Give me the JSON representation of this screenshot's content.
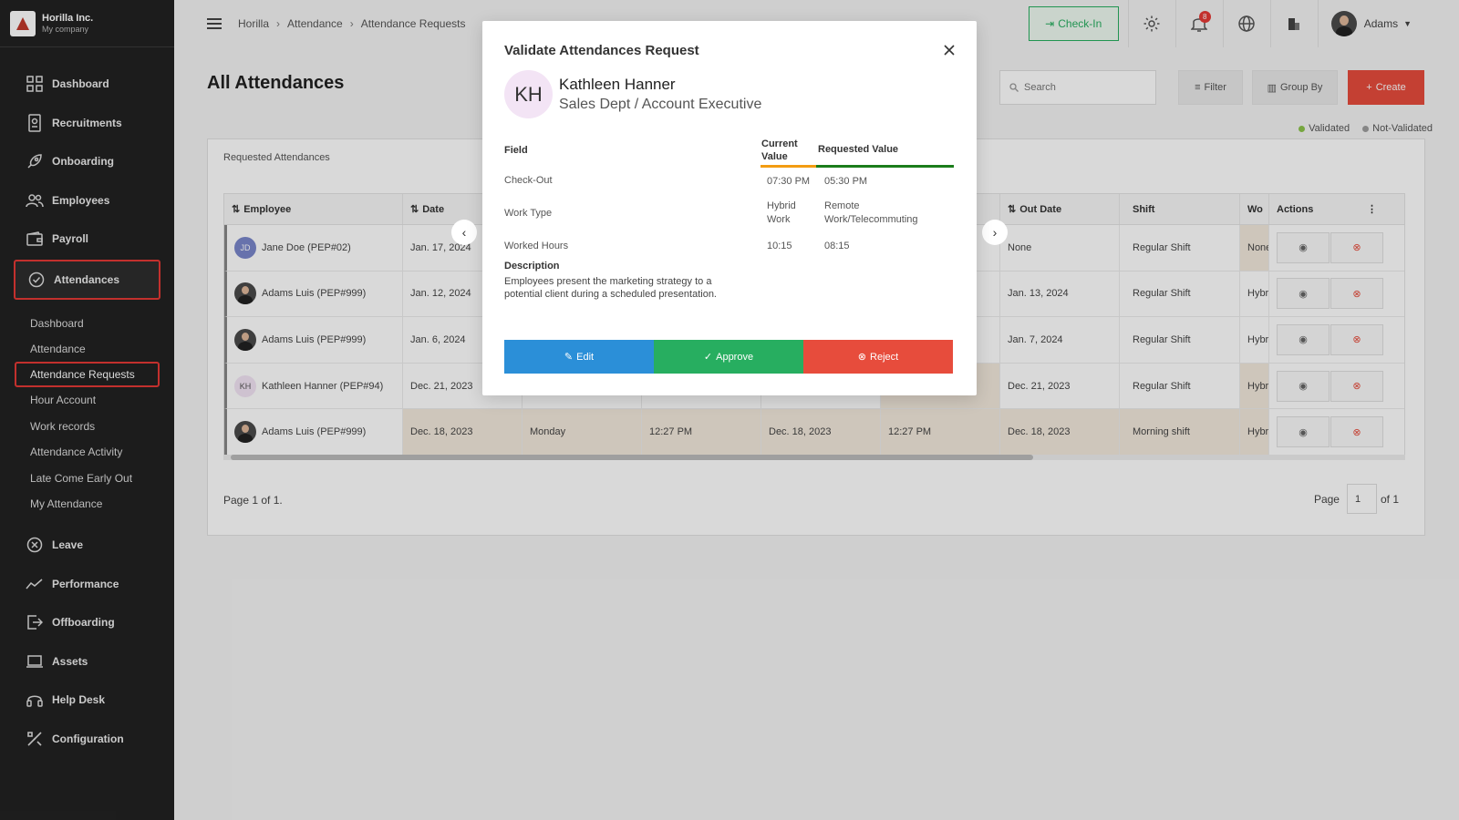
{
  "brand": {
    "name": "Horilla Inc.",
    "sub": "My company"
  },
  "sidebar": {
    "top_items": [
      {
        "label": "Dashboard",
        "icon": "grid-icon"
      },
      {
        "label": "Recruitments",
        "icon": "id-card-icon"
      },
      {
        "label": "Onboarding",
        "icon": "rocket-icon"
      },
      {
        "label": "Employees",
        "icon": "users-icon"
      },
      {
        "label": "Payroll",
        "icon": "wallet-icon"
      }
    ],
    "active_item": {
      "label": "Attendances",
      "icon": "check-circle-icon"
    },
    "sub_items": [
      "Dashboard",
      "Attendance",
      "Attendance Requests",
      "Hour Account",
      "Work records",
      "Attendance Activity",
      "Late Come Early Out",
      "My Attendance"
    ],
    "bottom_items": [
      {
        "label": "Leave",
        "icon": "x-circle-icon"
      },
      {
        "label": "Performance",
        "icon": "trend-icon"
      },
      {
        "label": "Offboarding",
        "icon": "exit-icon"
      },
      {
        "label": "Assets",
        "icon": "laptop-icon"
      },
      {
        "label": "Help Desk",
        "icon": "headset-icon"
      },
      {
        "label": "Configuration",
        "icon": "tools-icon"
      }
    ]
  },
  "breadcrumb": [
    "Horilla",
    "Attendance",
    "Attendance Requests"
  ],
  "topbar": {
    "checkin_label": "Check-In",
    "notification_count": "8",
    "user_name": "Adams"
  },
  "page": {
    "title": "All Attendances",
    "search_placeholder": "Search",
    "filter_label": "Filter",
    "groupby_label": "Group By",
    "create_label": "Create",
    "legend": [
      {
        "label": "Validated",
        "color": "#8bc34a"
      },
      {
        "label": "Not-Validated",
        "color": "#9e9e9e"
      }
    ],
    "card_label": "Requested Attendances",
    "page_info": "Page 1 of 1.",
    "pager_label": "Page",
    "pager_value": "1",
    "pager_total": "of 1"
  },
  "table": {
    "columns": [
      "Employee",
      "Date",
      "",
      "",
      "",
      "",
      "Out Date",
      "Shift",
      "Wo",
      "Actions"
    ],
    "rows": [
      {
        "employee": "Jane Doe (PEP#02)",
        "avatar": "JD",
        "date": "Jan. 17, 2024",
        "day": "",
        "in_time": "",
        "in_date": "",
        "out_time": "",
        "out_date": "None",
        "shift": "Regular Shift",
        "work": "None",
        "highlight": false
      },
      {
        "employee": "Adams Luis (PEP#999)",
        "avatar": "",
        "date": "Jan. 12, 2024",
        "day": "",
        "in_time": "",
        "in_date": "",
        "out_time": "",
        "out_date": "Jan. 13, 2024",
        "shift": "Regular Shift",
        "work": "Hybr",
        "highlight": false
      },
      {
        "employee": "Adams Luis (PEP#999)",
        "avatar": "",
        "date": "Jan. 6, 2024",
        "day": "",
        "in_time": "",
        "in_date": "",
        "out_time": "",
        "out_date": "Jan. 7, 2024",
        "shift": "Regular Shift",
        "work": "Hybr",
        "highlight": false
      },
      {
        "employee": "Kathleen Hanner (PEP#94)",
        "avatar": "KH",
        "date": "Dec. 21, 2023",
        "day": "",
        "in_time": "",
        "in_date": "",
        "out_time": "",
        "out_date": "Dec. 21, 2023",
        "shift": "Regular Shift",
        "work": "Hybr",
        "highlight": false
      },
      {
        "employee": "Adams Luis (PEP#999)",
        "avatar": "",
        "date": "Dec. 18, 2023",
        "day": "Monday",
        "in_time": "12:27 PM",
        "in_date": "Dec. 18, 2023",
        "out_time": "12:27 PM",
        "out_date": "Dec. 18, 2023",
        "shift": "Morning shift",
        "work": "Hybr",
        "highlight": true
      }
    ]
  },
  "modal": {
    "title": "Validate Attendances Request",
    "avatar": "KH",
    "name": "Kathleen Hanner",
    "dept": "Sales Dept / Account Executive",
    "headers": {
      "field": "Field",
      "current": "Current Value",
      "requested": "Requested Value"
    },
    "rows": [
      {
        "field": "Check-Out",
        "current": "07:30 PM",
        "requested": "05:30 PM"
      },
      {
        "field": "Work Type",
        "current": "Hybrid Work",
        "requested": "Remote Work/Telecommuting"
      },
      {
        "field": "Worked Hours",
        "current": "10:15",
        "requested": "08:15"
      }
    ],
    "desc_label": "Description",
    "description": "Employees present the marketing strategy to a potential client during a scheduled presentation.",
    "edit_label": "Edit",
    "approve_label": "Approve",
    "reject_label": "Reject"
  },
  "colors": {
    "accent": "#e74c3c",
    "edit": "#2b8fd8",
    "approve": "#27ae60",
    "reject": "#e74c3c",
    "current_bar": "#f39c12",
    "requested_bar": "#1b7d1b"
  }
}
